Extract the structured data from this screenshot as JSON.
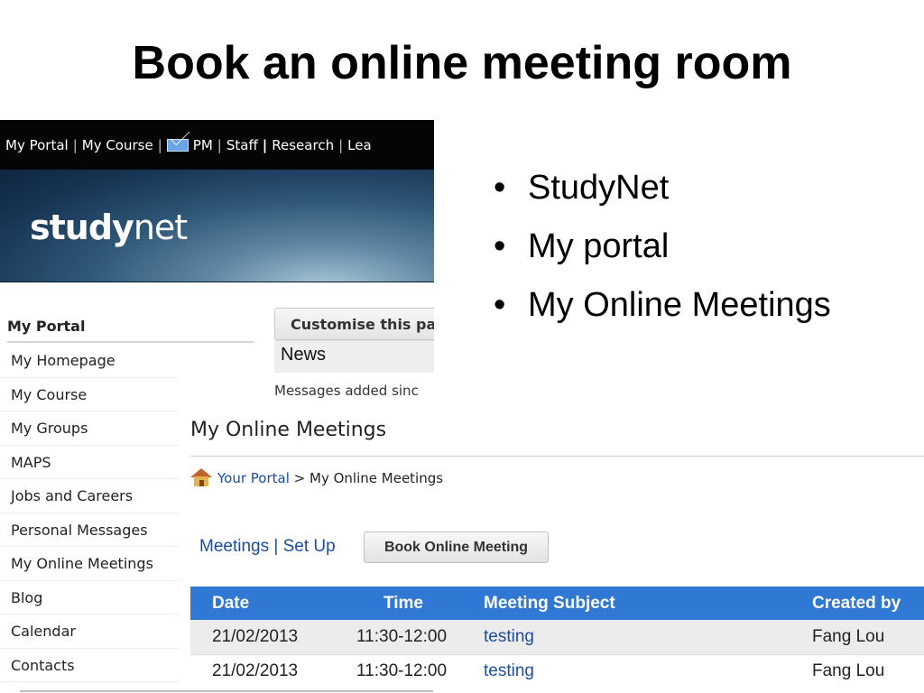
{
  "slide": {
    "title": "Book an online meeting room",
    "bullets": [
      "StudyNet",
      "My portal",
      "My Online Meetings"
    ]
  },
  "topnav": {
    "items": [
      "My Portal",
      "My Course",
      "PM",
      "Staff",
      "Research",
      "Lea"
    ],
    "icons": {
      "mail": "mail-icon"
    }
  },
  "banner": {
    "logo_bold": "study",
    "logo_light": "net"
  },
  "sidebar": {
    "heading": "My Portal",
    "items": [
      {
        "label": "My Homepage"
      },
      {
        "label": "My Course"
      },
      {
        "label": "My Groups"
      },
      {
        "label": "MAPS"
      },
      {
        "label": "Jobs and Careers"
      },
      {
        "label": "Personal Messages"
      },
      {
        "label": "My Online Meetings"
      },
      {
        "label": "Blog"
      },
      {
        "label": "Calendar"
      },
      {
        "label": "Contacts"
      }
    ]
  },
  "content": {
    "customise_label": "Customise this pa",
    "news_label": "News",
    "messages_text": "Messages added sinc",
    "section_title": "My Online Meetings",
    "breadcrumb": {
      "home_link": "Your Portal",
      "sep": ">",
      "current": "My Online Meetings"
    },
    "meetings_links": "Meetings | Set Up",
    "book_button": "Book Online Meeting",
    "table": {
      "headers": [
        "Date",
        "Time",
        "Meeting Subject",
        "Created by"
      ],
      "rows": [
        [
          "21/02/2013",
          "11:30-12:00",
          "testing",
          "Fang Lou"
        ],
        [
          "21/02/2013",
          "11:30-12:00",
          "testing",
          "Fang Lou"
        ]
      ]
    }
  },
  "colors": {
    "table_header": "#2f78d4",
    "link": "#1a4fa0",
    "topnav_bg": "#050505",
    "banner_dark": "#173453"
  }
}
